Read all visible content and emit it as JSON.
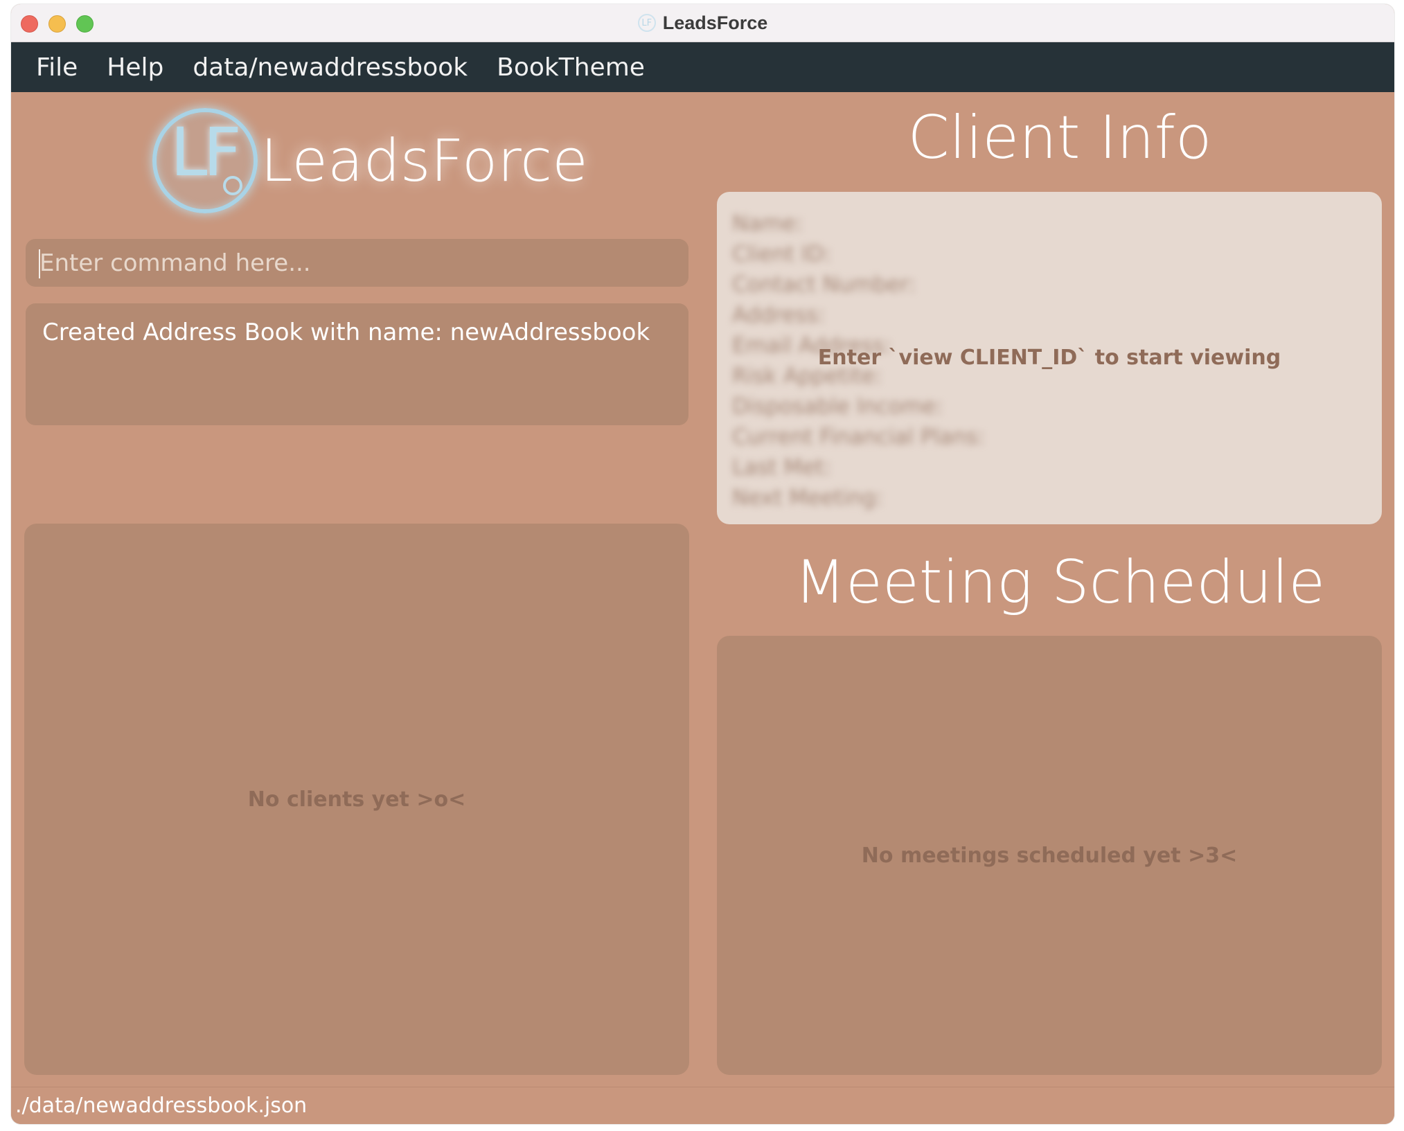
{
  "window": {
    "title": "LeadsForce",
    "title_icon_text": "LF"
  },
  "menu": {
    "items": [
      "File",
      "Help",
      "data/newaddressbook",
      "BookTheme"
    ]
  },
  "brand": {
    "logo_text": "LF",
    "name": "LeadsForce"
  },
  "command": {
    "placeholder": "Enter command here...",
    "value": ""
  },
  "result": {
    "text": "Created Address Book with name: newAddressbook"
  },
  "client_list": {
    "empty_text": "No clients yet >o<"
  },
  "client_info": {
    "title": "Client Info",
    "fields": [
      "Name:",
      "Client ID:",
      "Contact Number:",
      "Address:",
      "Email Address:",
      "Risk Appetite:",
      "Disposable Income:",
      "Current Financial Plans:",
      "Last Met:",
      "Next Meeting:"
    ],
    "hint": "Enter `view CLIENT_ID` to start viewing"
  },
  "meetings": {
    "title": "Meeting Schedule",
    "empty_text": "No meetings scheduled yet >3<"
  },
  "status": {
    "path": "./data/newaddressbook.json"
  },
  "colors": {
    "background": "#c9977e",
    "panel": "#b48a72",
    "menubar": "#263238",
    "client_info_bg": "#e6d9d0",
    "logo_glow": "#a9d3e6"
  }
}
